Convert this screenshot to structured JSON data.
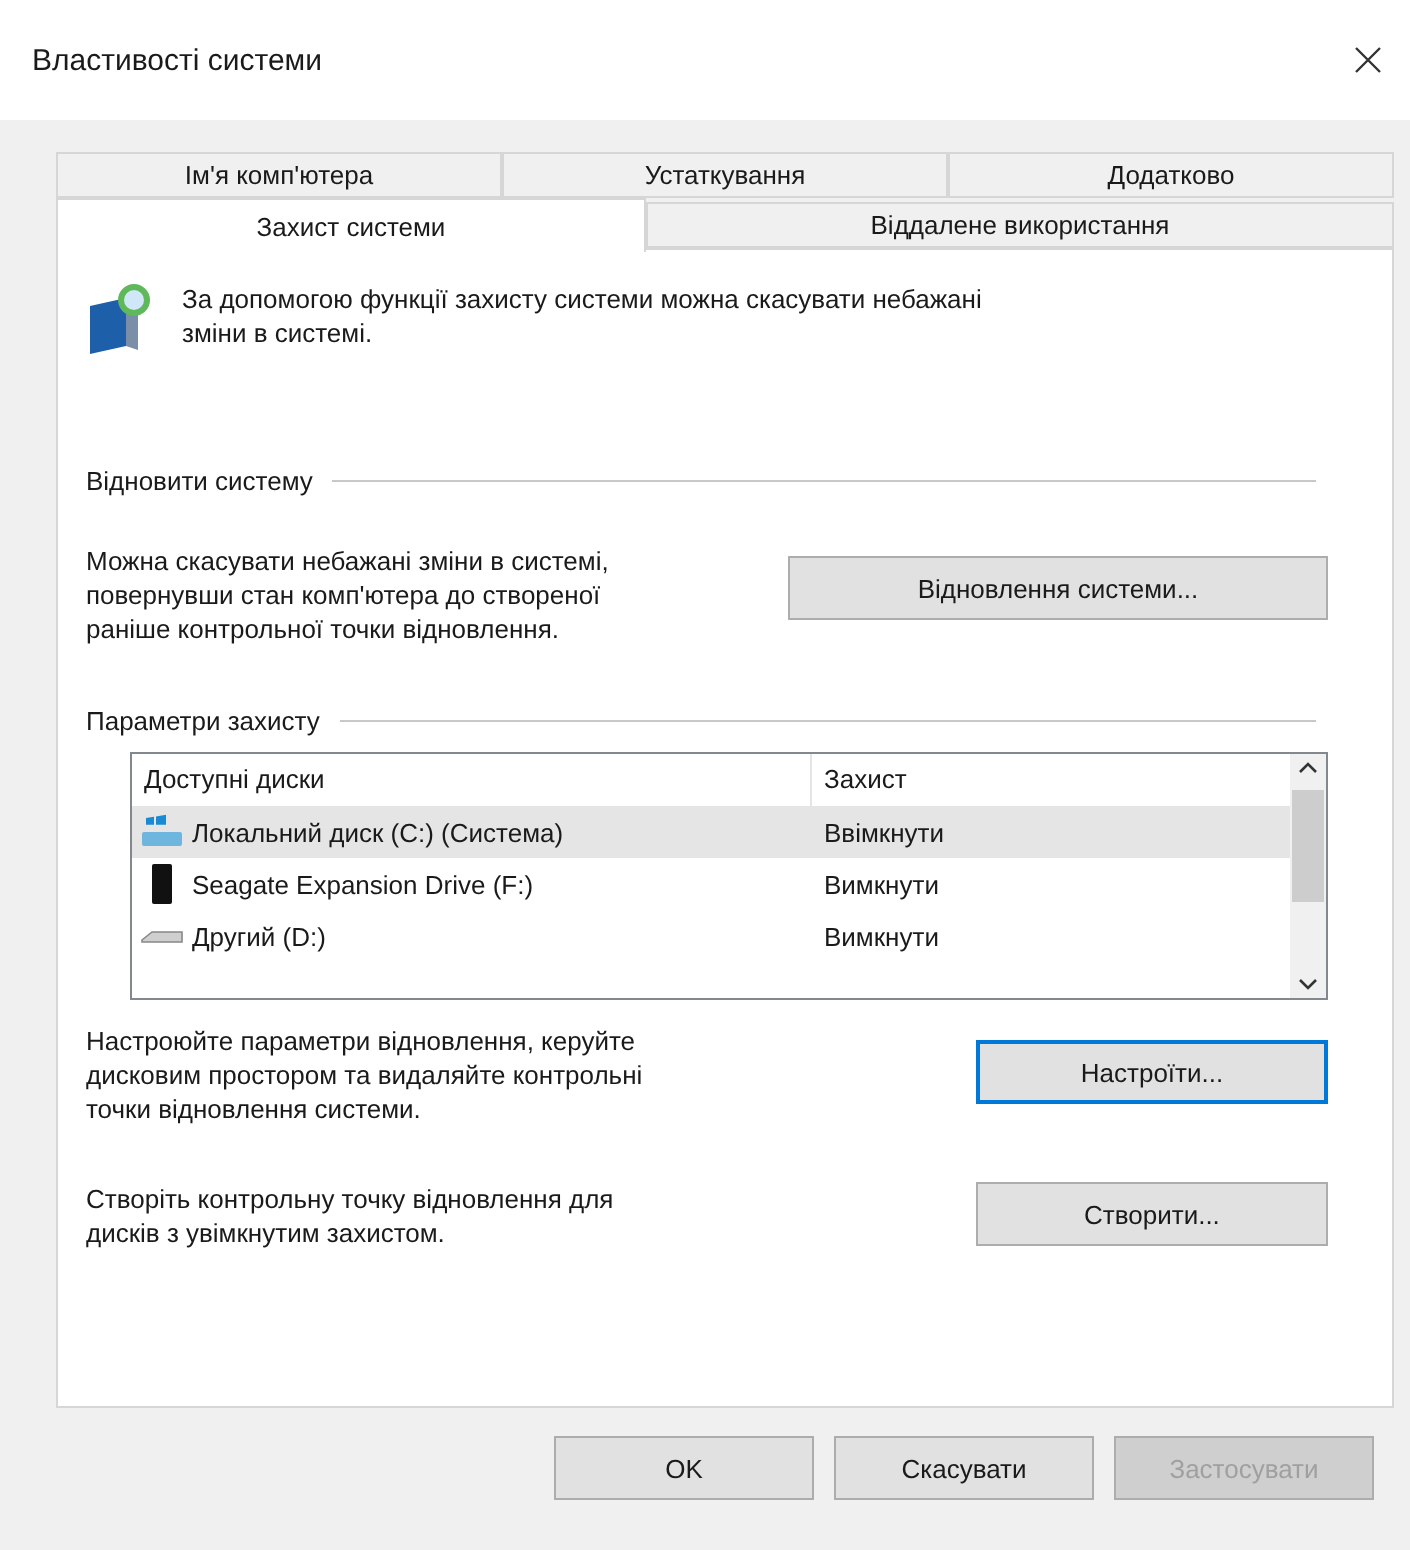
{
  "window": {
    "title": "Властивості системи"
  },
  "tab_rows": [
    [
      {
        "label": "Ім'я комп'ютера",
        "selected": false
      },
      {
        "label": "Устаткування",
        "selected": false
      },
      {
        "label": "Додатково",
        "selected": false
      }
    ],
    [
      {
        "label": "Захист системи",
        "selected": true
      },
      {
        "label": "Віддалене використання",
        "selected": false
      }
    ]
  ],
  "intro": "За допомогою функції захисту системи можна скасувати небажані зміни в системі.",
  "restore": {
    "heading": "Відновити систему",
    "description": "Можна скасувати небажані зміни в системі, повернувши стан комп'ютера до створеної раніше контрольної точки відновлення.",
    "button": "Відновлення системи..."
  },
  "protection": {
    "heading": "Параметри захисту",
    "columns": [
      "Доступні диски",
      "Захист"
    ],
    "rows": [
      {
        "kind": "system",
        "drive": "Локальний диск (C:) (Система)",
        "protection": "Ввімкнути",
        "selected": true
      },
      {
        "kind": "external",
        "drive": "Seagate Expansion Drive (F:)",
        "protection": "Вимкнути",
        "selected": false
      },
      {
        "kind": "disk",
        "drive": "Другий (D:)",
        "protection": "Вимкнути",
        "selected": false
      }
    ],
    "configure": {
      "description": "Настроюйте параметри відновлення, керуйте дисковим простором та видаляйте контрольні точки відновлення системи.",
      "button": "Настроїти...",
      "focused": true
    },
    "create": {
      "description": "Створіть контрольну точку відновлення для дисків з увімкнутим захистом.",
      "button": "Створити...",
      "focused": false
    }
  },
  "buttons": [
    {
      "label": "OK",
      "disabled": false
    },
    {
      "label": "Скасувати",
      "disabled": false
    },
    {
      "label": "Застосувати",
      "disabled": true
    }
  ]
}
